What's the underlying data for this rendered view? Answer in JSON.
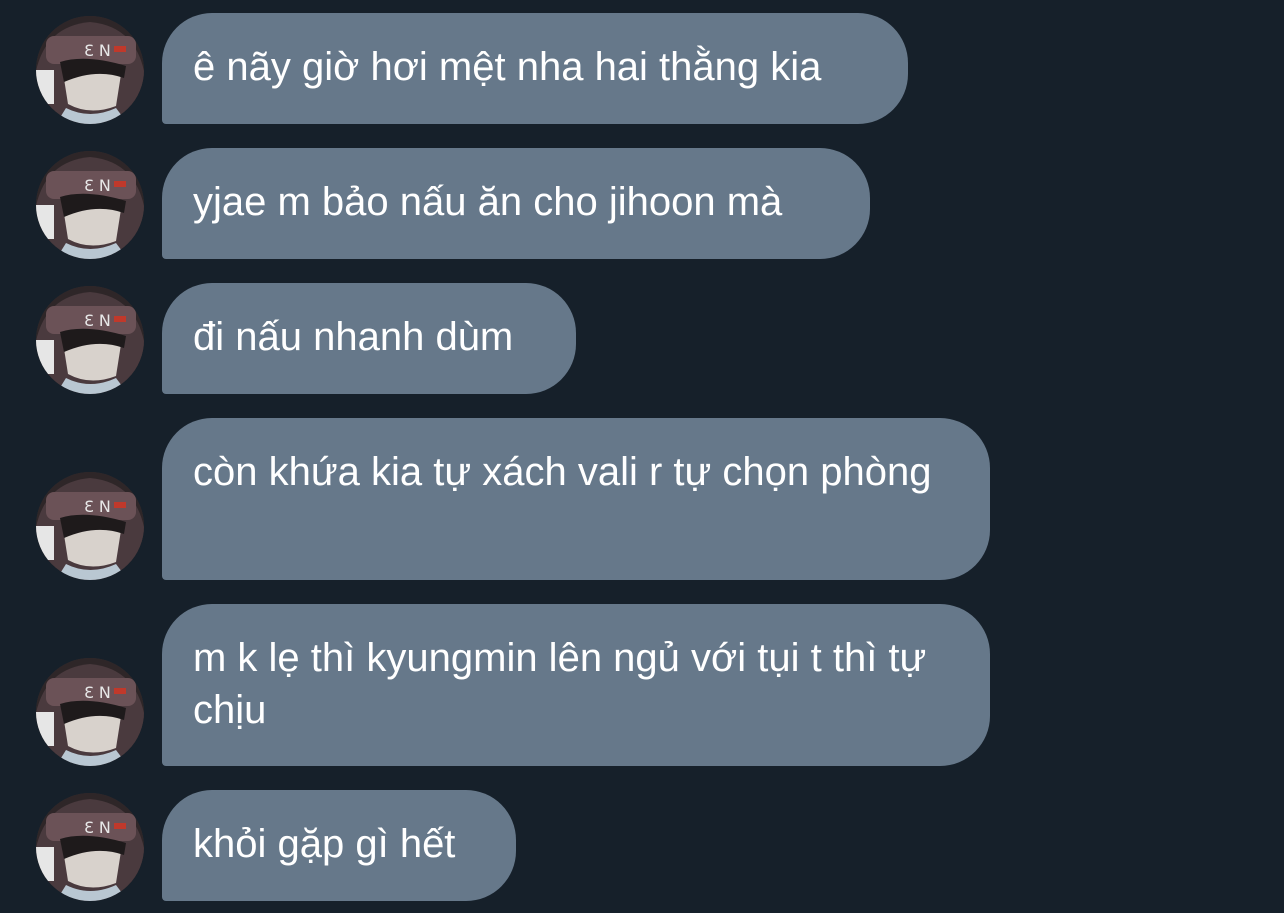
{
  "colors": {
    "background": "#16202a",
    "bubble": "#66788a",
    "text": "#ffffff"
  },
  "messages": [
    {
      "text": "ê nãy giờ hơi mệt nha hai thằng kia"
    },
    {
      "text": "yjae m bảo nấu ăn cho jihoon mà"
    },
    {
      "text": "đi nấu nhanh dùm"
    },
    {
      "text": "còn khứa kia tự xách vali r tự chọn phòng"
    },
    {
      "text": "m k lẹ thì kyungmin lên ngủ với tụi t thì tự chịu"
    },
    {
      "text": "khỏi gặp gì hết"
    }
  ]
}
